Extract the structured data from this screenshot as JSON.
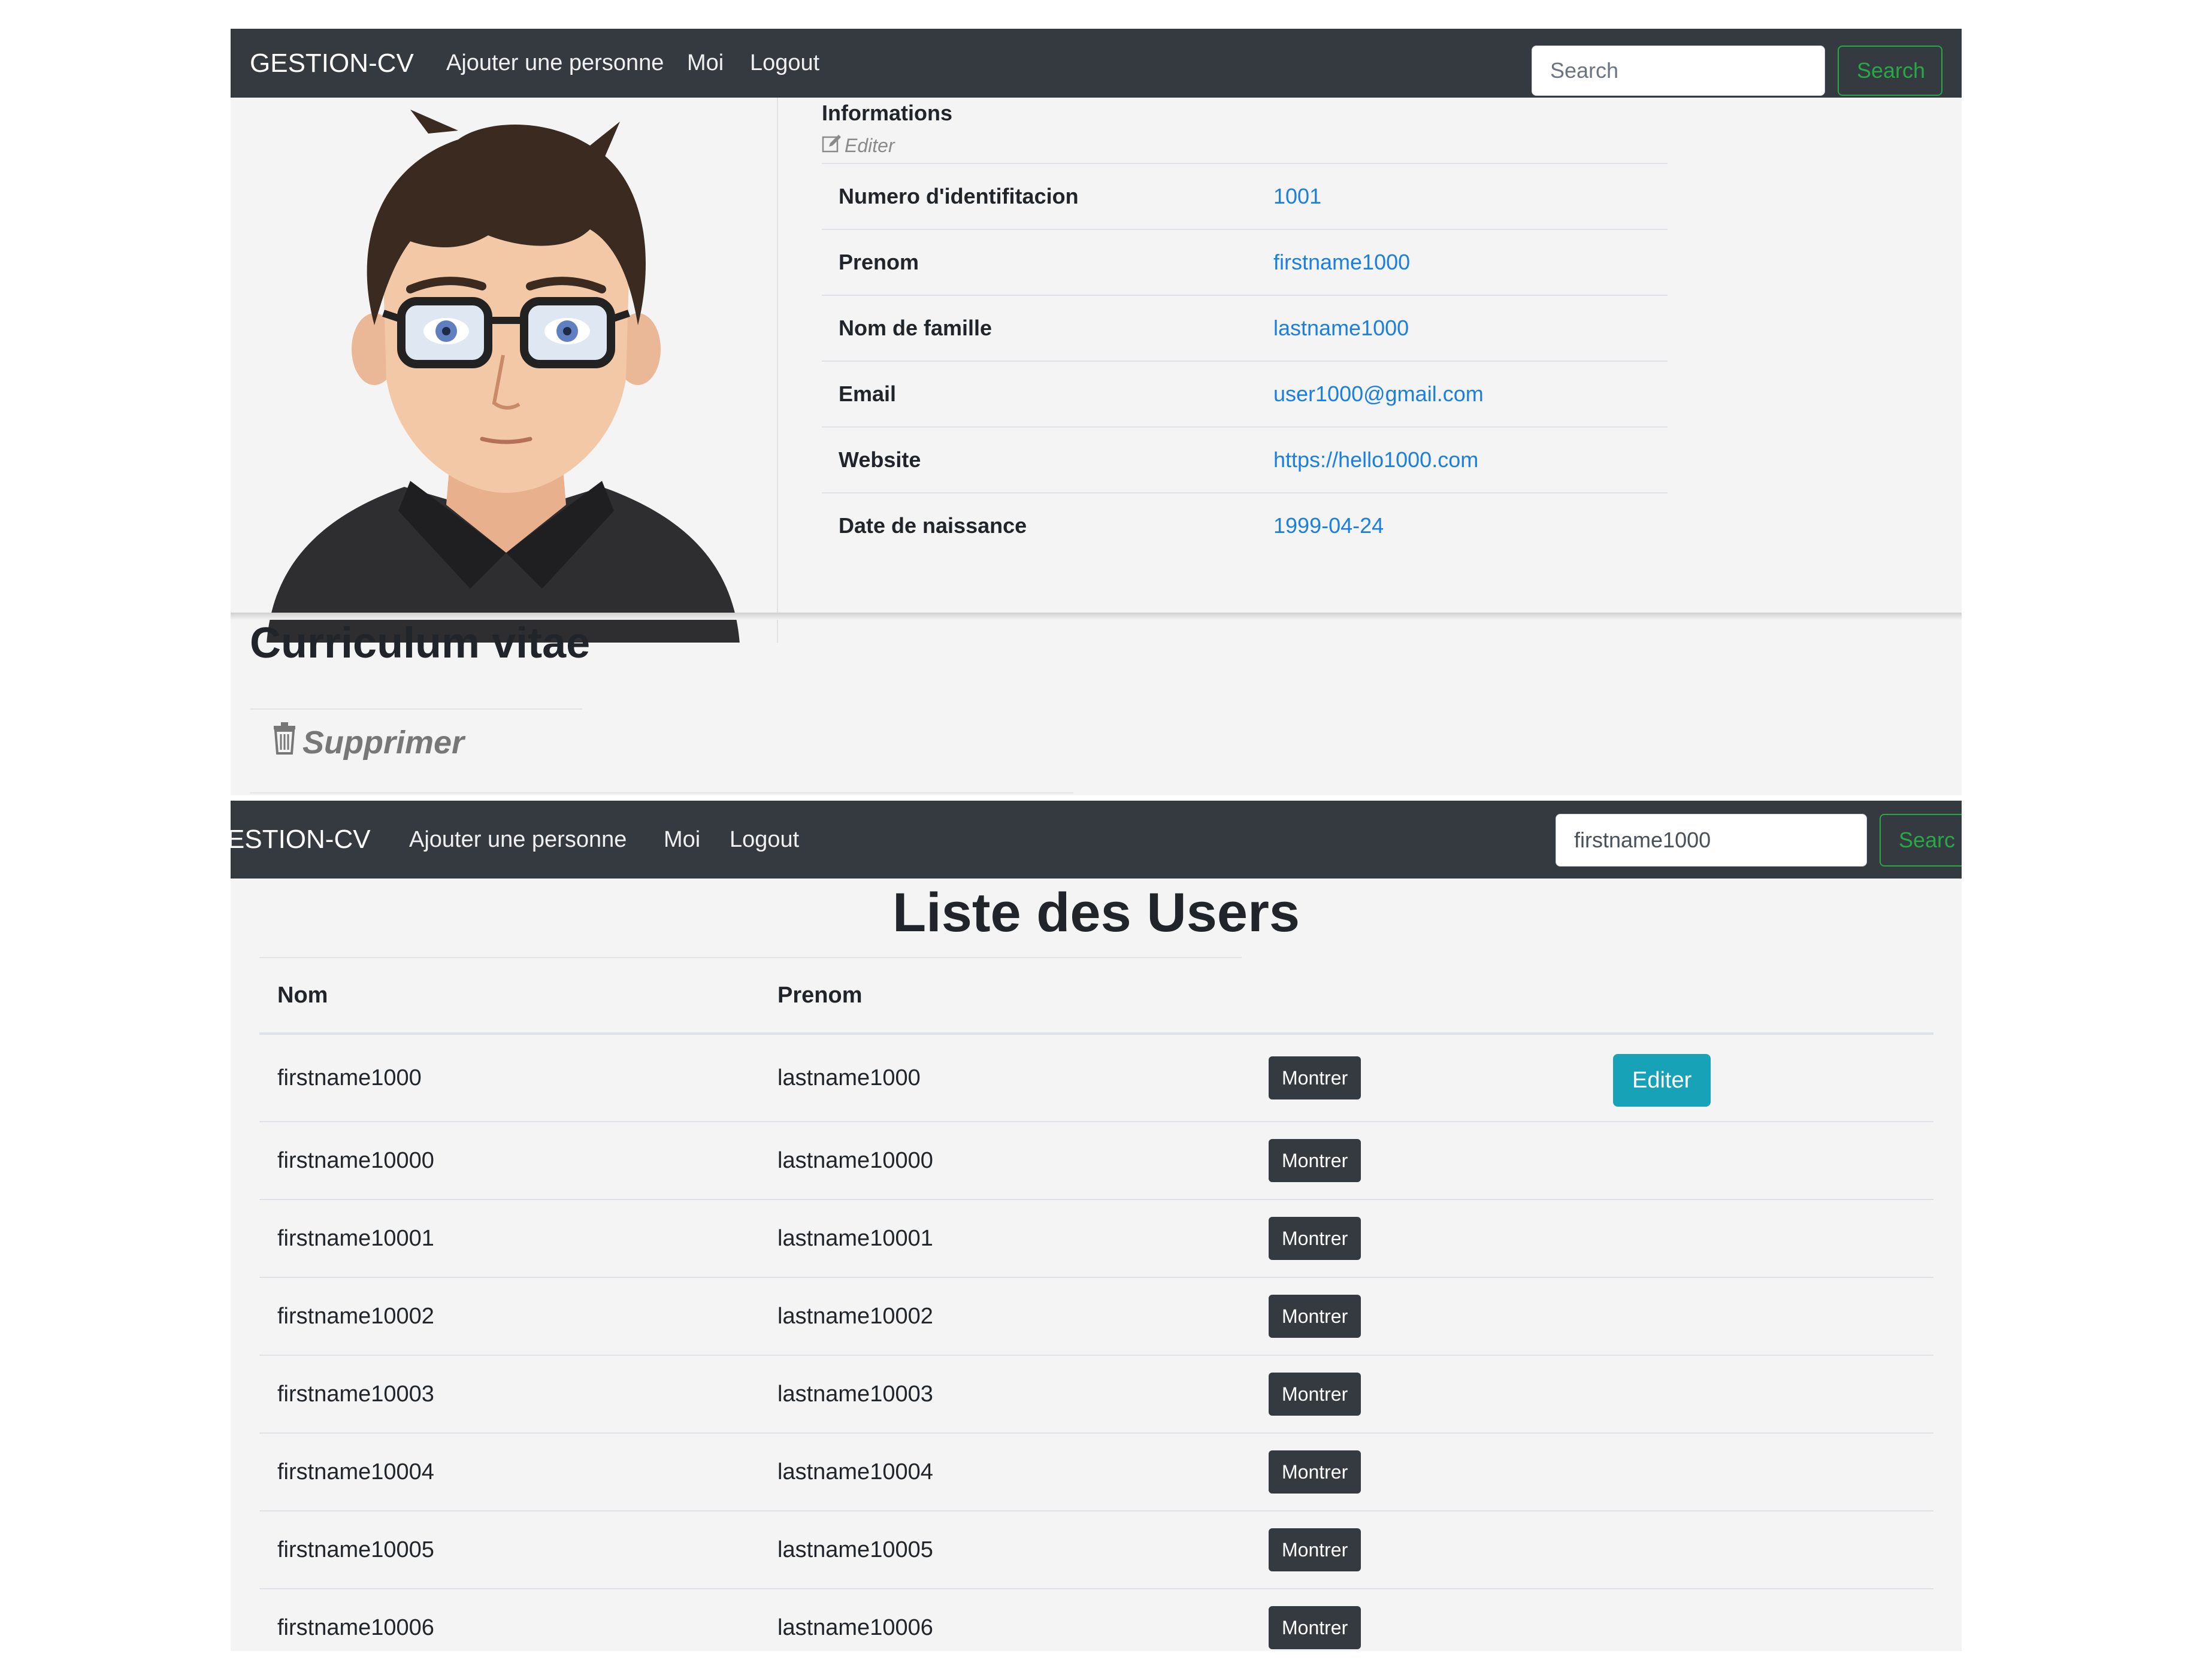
{
  "profile_view": {
    "navbar": {
      "brand": "GESTION-CV",
      "links": [
        "Ajouter une personne",
        "Moi",
        "Logout"
      ],
      "search_placeholder": "Search",
      "search_value": "",
      "search_button": "Search"
    },
    "info": {
      "title": "Informations",
      "edit_label": "Editer",
      "rows": [
        {
          "label": "Numero d'identifitacion",
          "value": "1001"
        },
        {
          "label": "Prenom",
          "value": "firstname1000"
        },
        {
          "label": "Nom de famille",
          "value": "lastname1000"
        },
        {
          "label": "Email",
          "value": "user1000@gmail.com"
        },
        {
          "label": "Website",
          "value": "https://hello1000.com"
        },
        {
          "label": "Date de naissance",
          "value": "1999-04-24"
        }
      ]
    },
    "cv_title": "Curriculum vitae",
    "delete_label": "Supprimer"
  },
  "users_view": {
    "navbar": {
      "brand": "ESTION-CV",
      "links": [
        "Ajouter une personne",
        "Moi",
        "Logout"
      ],
      "search_value": "firstname1000",
      "search_button": "Searc"
    },
    "title": "Liste des Users",
    "columns": [
      "Nom",
      "Prenom"
    ],
    "show_label": "Montrer",
    "edit_label": "Editer",
    "rows": [
      {
        "nom": "firstname1000",
        "prenom": "lastname1000"
      },
      {
        "nom": "firstname10000",
        "prenom": "lastname10000"
      },
      {
        "nom": "firstname10001",
        "prenom": "lastname10001"
      },
      {
        "nom": "firstname10002",
        "prenom": "lastname10002"
      },
      {
        "nom": "firstname10003",
        "prenom": "lastname10003"
      },
      {
        "nom": "firstname10004",
        "prenom": "lastname10004"
      },
      {
        "nom": "firstname10005",
        "prenom": "lastname10005"
      },
      {
        "nom": "firstname10006",
        "prenom": "lastname10006"
      }
    ]
  },
  "icons": {
    "edit": "edit-icon",
    "delete": "trash-icon",
    "avatar": "avatar-image"
  },
  "colors": {
    "navbar": "#343a40",
    "link": "#1a7fe0",
    "search_btn": "#28a745",
    "edit_btn": "#17a2b8",
    "show_btn": "#343a40"
  }
}
